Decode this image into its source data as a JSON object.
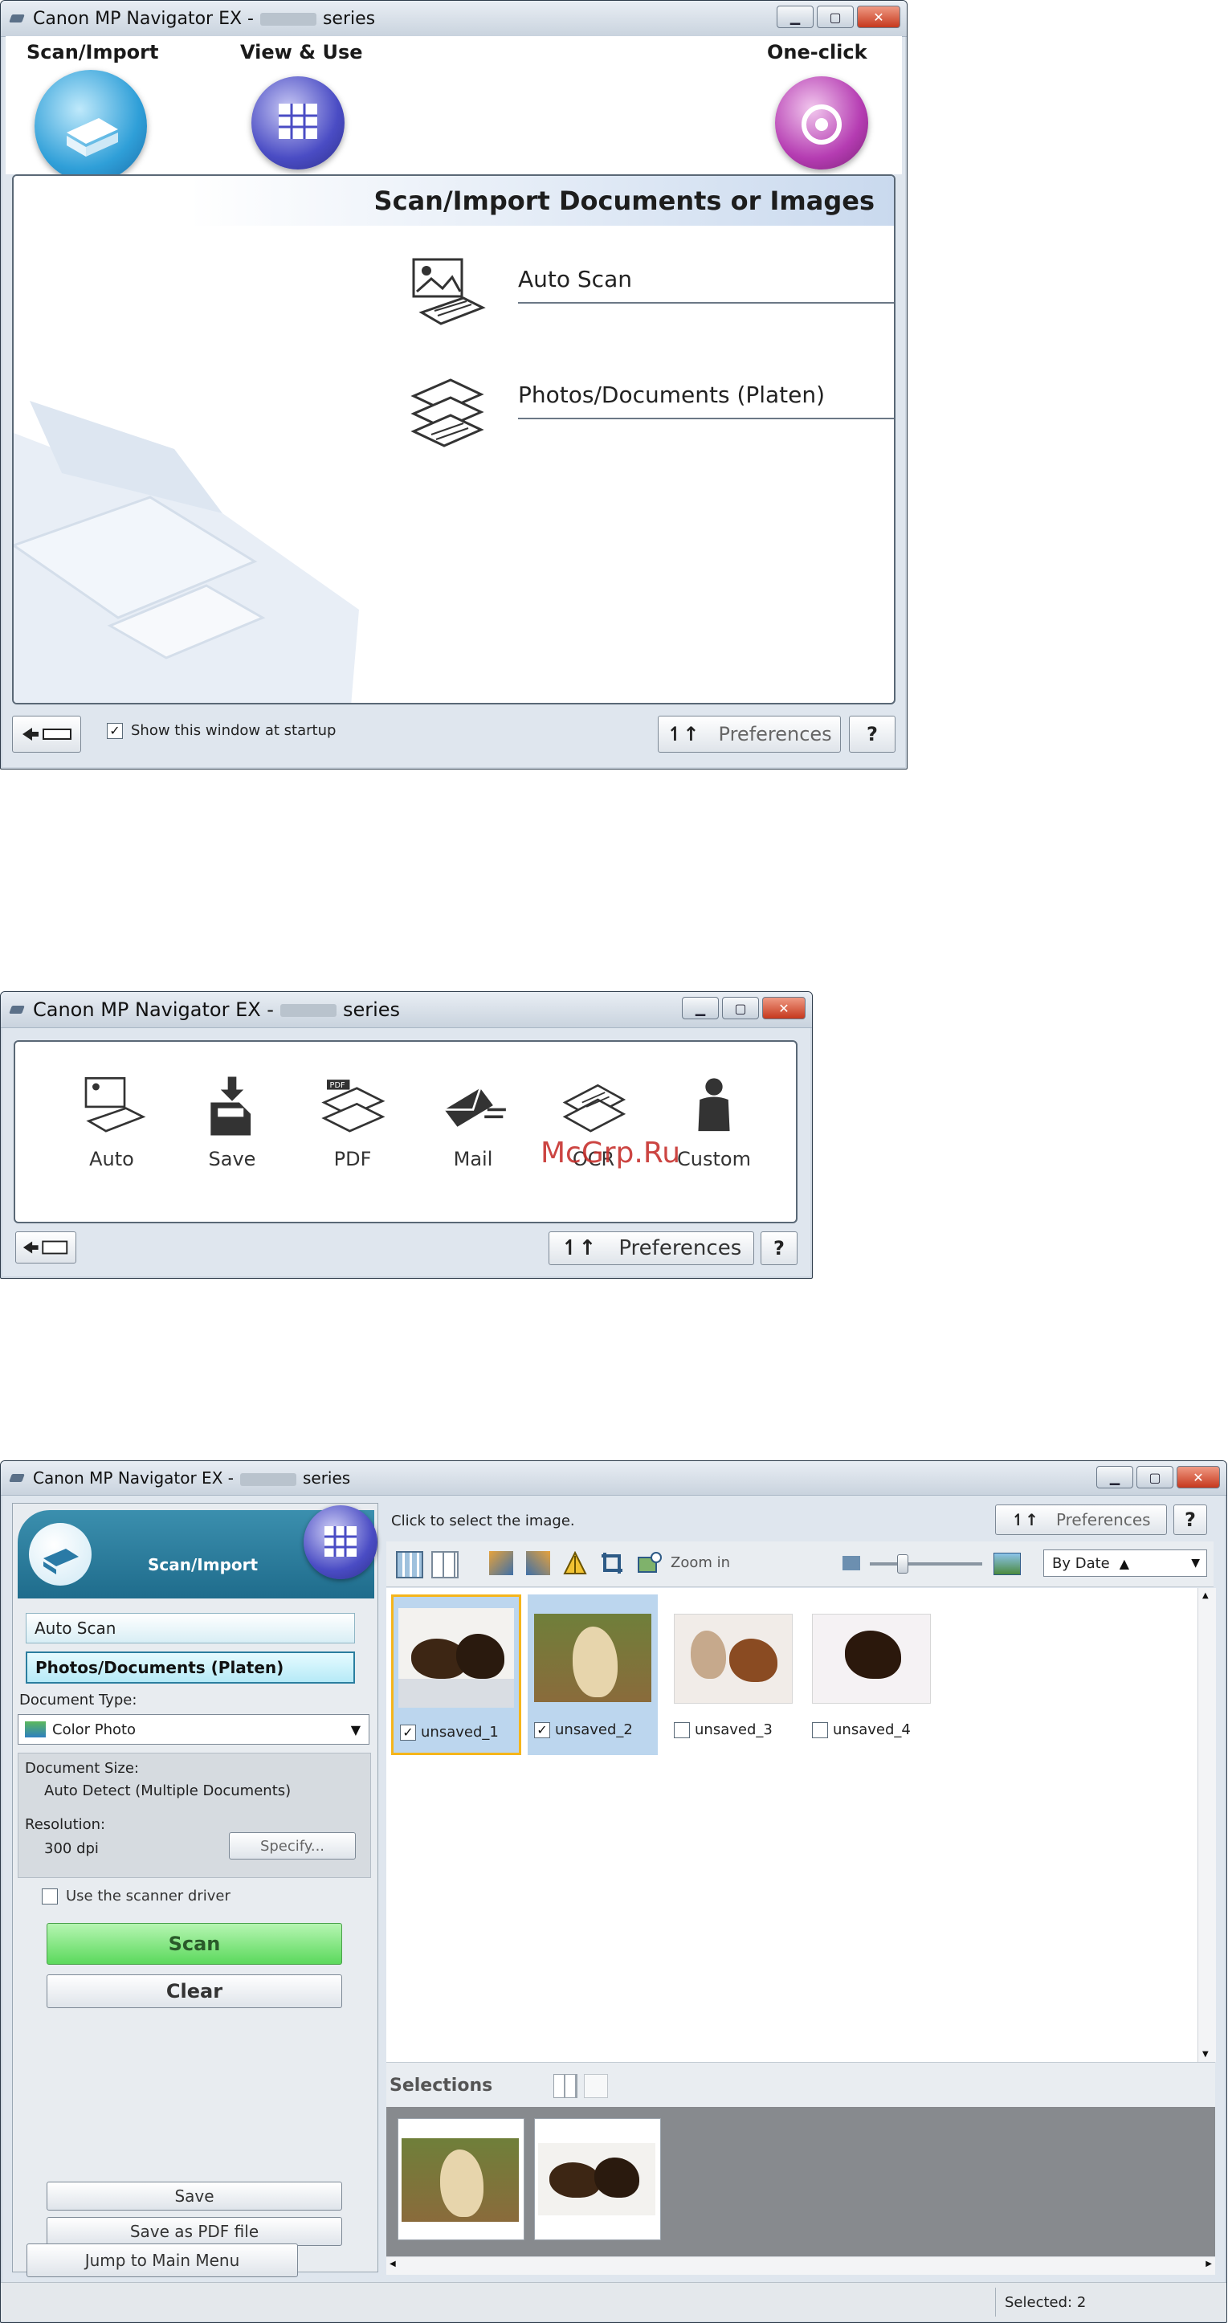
{
  "window1": {
    "title_prefix": "Canon MP Navigator EX -",
    "title_suffix": "series",
    "tabs": [
      {
        "label": "Scan/Import",
        "icon": "scanner-icon"
      },
      {
        "label": "View & Use",
        "icon": "grid-photos-icon"
      },
      {
        "label": "One-click",
        "icon": "one-click-icon"
      }
    ],
    "heading": "Scan/Import Documents or Images",
    "items": [
      {
        "label": "Auto Scan",
        "icon": "auto-scan-icon"
      },
      {
        "label": "Photos/Documents (Platen)",
        "icon": "platen-icon"
      }
    ],
    "show_startup_label": "Show this window at startup",
    "show_startup_checked": true,
    "preferences_label": "Preferences",
    "help_label": "?"
  },
  "window2": {
    "title_prefix": "Canon MP Navigator EX -",
    "title_suffix": "series",
    "buttons": [
      {
        "label": "Auto",
        "icon": "auto-scan-icon"
      },
      {
        "label": "Save",
        "icon": "save-icon"
      },
      {
        "label": "PDF",
        "icon": "pdf-icon"
      },
      {
        "label": "Mail",
        "icon": "mail-icon"
      },
      {
        "label": "OCR",
        "icon": "ocr-icon"
      },
      {
        "label": "Custom",
        "icon": "custom-user-icon"
      }
    ],
    "preferences_label": "Preferences",
    "help_label": "?",
    "watermark": "McGrp.Ru"
  },
  "window3": {
    "title_prefix": "Canon MP Navigator EX -",
    "title_suffix": "series",
    "header_label": "Scan/Import",
    "instruction": "Click to select the image.",
    "preferences_label": "Preferences",
    "help_label": "?",
    "zoom_label": "Zoom in",
    "sort_value": "By Date",
    "modes": [
      "Auto Scan",
      "Photos/Documents (Platen)"
    ],
    "document_type_label": "Document Type:",
    "document_type_value": "Color Photo",
    "document_size_label": "Document Size:",
    "document_size_value": "Auto Detect (Multiple Documents)",
    "resolution_label": "Resolution:",
    "resolution_value": "300 dpi",
    "specify_label": "Specify...",
    "scanner_driver_label": "Use the scanner driver",
    "scanner_driver_checked": false,
    "scan_label": "Scan",
    "clear_label": "Clear",
    "save_label": "Save",
    "save_pdf_label": "Save as PDF file",
    "jump_label": "Jump to Main Menu",
    "thumbnails": [
      {
        "label": "unsaved_1",
        "checked": true
      },
      {
        "label": "unsaved_2",
        "checked": true
      },
      {
        "label": "unsaved_3",
        "checked": false
      },
      {
        "label": "unsaved_4",
        "checked": false
      }
    ],
    "selections_label": "Selections",
    "status": "Selected: 2"
  }
}
